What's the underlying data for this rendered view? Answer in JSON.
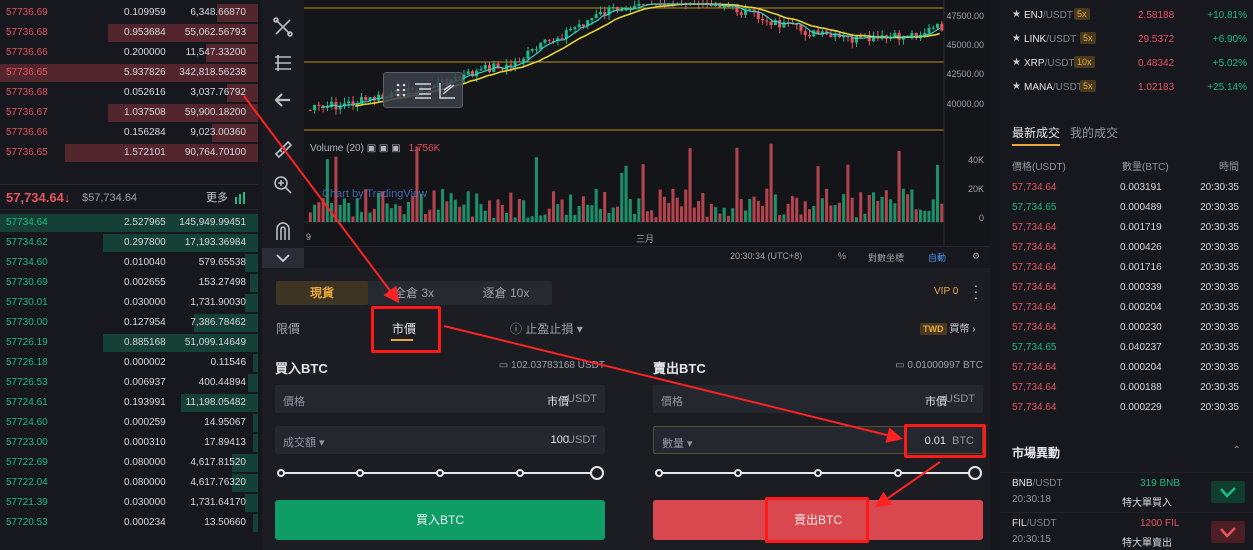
{
  "order_book": {
    "asks": [
      {
        "price": "57736.69",
        "amount": "0.109959",
        "total": "6,348.66870",
        "depth": 0.16
      },
      {
        "price": "57736.68",
        "amount": "0.953684",
        "total": "55,062.56793",
        "depth": 0.58
      },
      {
        "price": "57736.66",
        "amount": "0.200000",
        "total": "11,547.33200",
        "depth": 0.2
      },
      {
        "price": "57736.65",
        "amount": "5.937826",
        "total": "342,818.56238",
        "depth": 1.0
      },
      {
        "price": "57736.68",
        "amount": "0.052616",
        "total": "3,037.76792",
        "depth": 0.12
      },
      {
        "price": "57736.67",
        "amount": "1.037508",
        "total": "59,900.18200",
        "depth": 0.58
      },
      {
        "price": "57736.66",
        "amount": "0.156284",
        "total": "9,023.00360",
        "depth": 0.18
      },
      {
        "price": "57736.65",
        "amount": "1.572101",
        "total": "90,764.70100",
        "depth": 0.75
      }
    ],
    "ticker": {
      "last": "57,734.64",
      "arrow": "↓",
      "usd": "$57,734.64",
      "more": "更多"
    },
    "bids": [
      {
        "price": "57734.64",
        "amount": "2.527965",
        "total": "145,949.99451",
        "depth": 1.0
      },
      {
        "price": "57734.62",
        "amount": "0.297800",
        "total": "17,193.36984",
        "depth": 0.6
      },
      {
        "price": "57734.60",
        "amount": "0.010040",
        "total": "579.65538",
        "depth": 0.05
      },
      {
        "price": "57730.69",
        "amount": "0.002655",
        "total": "153.27498",
        "depth": 0.03
      },
      {
        "price": "57730.01",
        "amount": "0.030000",
        "total": "1,731.90030",
        "depth": 0.05
      },
      {
        "price": "57730.00",
        "amount": "0.127954",
        "total": "7,386.78462",
        "depth": 0.25
      },
      {
        "price": "57726.19",
        "amount": "0.885168",
        "total": "51,099.14649",
        "depth": 0.6
      },
      {
        "price": "57726.18",
        "amount": "0.000002",
        "total": "0.11546",
        "depth": 0.02
      },
      {
        "price": "57726.53",
        "amount": "0.006937",
        "total": "400.44894",
        "depth": 0.04
      },
      {
        "price": "57724.61",
        "amount": "0.193991",
        "total": "11,198.05482",
        "depth": 0.3
      },
      {
        "price": "57724.60",
        "amount": "0.000259",
        "total": "14.95067",
        "depth": 0.02
      },
      {
        "price": "57723.00",
        "amount": "0.000310",
        "total": "17.89413",
        "depth": 0.02
      },
      {
        "price": "57722.69",
        "amount": "0.080000",
        "total": "4,617.81520",
        "depth": 0.1
      },
      {
        "price": "57722.04",
        "amount": "0.080000",
        "total": "4,617.76320",
        "depth": 0.1
      },
      {
        "price": "57721.39",
        "amount": "0.030000",
        "total": "1,731.64170",
        "depth": 0.05
      },
      {
        "price": "57720.53",
        "amount": "0.000234",
        "total": "13.50660",
        "depth": 0.02
      }
    ]
  },
  "chart": {
    "price_axis": [
      "47500.00",
      "45000.00",
      "42500.00",
      "40000.00"
    ],
    "volume_axis": [
      "40K",
      "20K",
      "0"
    ],
    "volume_title": "Volume (20)",
    "volume_value": "1.756K",
    "watermark": "Chart by TradingView",
    "month_label": "三月",
    "left_tick": "9",
    "footer": {
      "time": "20:30:34 (UTC+8)",
      "percent": "%",
      "log": "對數坐標",
      "auto": "自動"
    }
  },
  "trade_panel": {
    "mode_tabs": {
      "spot": "現貨",
      "cross": "全倉 3x",
      "isolated": "逐倉 10x"
    },
    "vip": "VIP 0",
    "order_tabs": {
      "limit": "限價",
      "market": "市價",
      "stop": "止盈止損"
    },
    "twd": {
      "badge": "TWD",
      "label": "買幣"
    },
    "buy": {
      "title": "買入BTC",
      "balance": "102.03783168 USDT",
      "price_label": "價格",
      "price_value": "市價",
      "price_unit": "USDT",
      "amount_label": "成交額",
      "amount_value": "100",
      "amount_unit": "USDT",
      "button": "買入BTC"
    },
    "sell": {
      "title": "賣出BTC",
      "balance": "0.01000997 BTC",
      "price_label": "價格",
      "price_value": "市價",
      "price_unit": "USDT",
      "amount_label": "數量",
      "amount_value": "0.01",
      "amount_unit": "BTC",
      "button": "賣出BTC"
    }
  },
  "favorites": [
    {
      "name": "ENJ",
      "quote": "/USDT",
      "lev": "5x",
      "price": "2.58188",
      "chg": "+10.81%"
    },
    {
      "name": "LINK",
      "quote": "/USDT",
      "lev": "5x",
      "price": "29.5372",
      "chg": "+6.90%"
    },
    {
      "name": "XRP",
      "quote": "/USDT",
      "lev": "10x",
      "price": "0.48342",
      "chg": "+5.02%"
    },
    {
      "name": "MANA",
      "quote": "/USDT",
      "lev": "5x",
      "price": "1.02183",
      "chg": "+25.14%"
    }
  ],
  "trades": {
    "tab_latest": "最新成交",
    "tab_mine": "我的成交",
    "head": {
      "price": "價格(USDT)",
      "qty": "數量(BTC)",
      "time": "時間"
    },
    "rows": [
      {
        "price": "57,734.64",
        "qty": "0.003191",
        "time": "20:30:35",
        "dir": "dn"
      },
      {
        "price": "57,734.65",
        "qty": "0.000489",
        "time": "20:30:35",
        "dir": "up"
      },
      {
        "price": "57,734.64",
        "qty": "0.001719",
        "time": "20:30:35",
        "dir": "dn"
      },
      {
        "price": "57,734.64",
        "qty": "0.000426",
        "time": "20:30:35",
        "dir": "dn"
      },
      {
        "price": "57,734.64",
        "qty": "0.001716",
        "time": "20:30:35",
        "dir": "dn"
      },
      {
        "price": "57,734.64",
        "qty": "0.000339",
        "time": "20:30:35",
        "dir": "dn"
      },
      {
        "price": "57,734.64",
        "qty": "0.000204",
        "time": "20:30:35",
        "dir": "dn"
      },
      {
        "price": "57,734.64",
        "qty": "0.000230",
        "time": "20:30:35",
        "dir": "dn"
      },
      {
        "price": "57,734.65",
        "qty": "0.040237",
        "time": "20:30:35",
        "dir": "up"
      },
      {
        "price": "57,734.64",
        "qty": "0.000204",
        "time": "20:30:35",
        "dir": "dn"
      },
      {
        "price": "57,734.64",
        "qty": "0.000188",
        "time": "20:30:35",
        "dir": "dn"
      },
      {
        "price": "57,734.64",
        "qty": "0.000229",
        "time": "20:30:35",
        "dir": "dn"
      }
    ]
  },
  "market_moves": {
    "title": "市場異動",
    "caret": "⌃",
    "rows": [
      {
        "name": "BNB",
        "quote": "/USDT",
        "time": "20:30:18",
        "amount": "319 BNB",
        "desc": "特大單買入",
        "color": "#1dbb85",
        "bg": "#0f3d2e"
      },
      {
        "name": "FIL",
        "quote": "/USDT",
        "time": "20:30:15",
        "amount": "1200 FIL",
        "desc": "特大單賣出",
        "color": "#e9535e",
        "bg": "#4a1e23"
      }
    ]
  },
  "colors": {
    "ask": "#e9535e",
    "bid": "#1dbb85",
    "accent": "#e8a83b",
    "annotation": "#ff1a1a"
  }
}
